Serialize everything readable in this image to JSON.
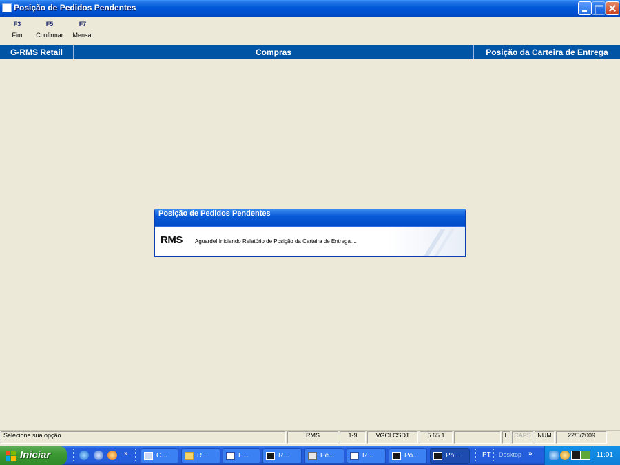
{
  "window": {
    "title": "Posição de Pedidos Pendentes"
  },
  "toolbar": {
    "keys": [
      {
        "key": "F3",
        "label": "Fim"
      },
      {
        "key": "F5",
        "label": "Confirmar"
      },
      {
        "key": "F7",
        "label": "Mensal"
      }
    ]
  },
  "header": {
    "left": "G-RMS Retail",
    "center": "Compras",
    "right": "Posição da Carteira de Entrega"
  },
  "dialog": {
    "title": "Posição de Pedidos Pendentes",
    "logo": "RMS",
    "message": "Aguarde! Iniciando Relatório de Posição da Carteira de Entrega...."
  },
  "statusbar": {
    "message": "Selecione sua opção",
    "system": "RMS",
    "range": "1-9",
    "user": "VGCLCSDT",
    "version": "5.65.1",
    "blank": "",
    "l": "L",
    "caps": "CAPS",
    "num": "NUM",
    "date": "22/5/2009"
  },
  "taskbar": {
    "start_label": "Iniciar",
    "buttons": [
      {
        "label": "C..."
      },
      {
        "label": "R..."
      },
      {
        "label": "E..."
      },
      {
        "label": "R..."
      },
      {
        "label": "Pe..."
      },
      {
        "label": "R..."
      },
      {
        "label": "Po..."
      },
      {
        "label": "Po..."
      }
    ],
    "language": "PT",
    "desktop": "Desktop",
    "clock": "11:01"
  }
}
